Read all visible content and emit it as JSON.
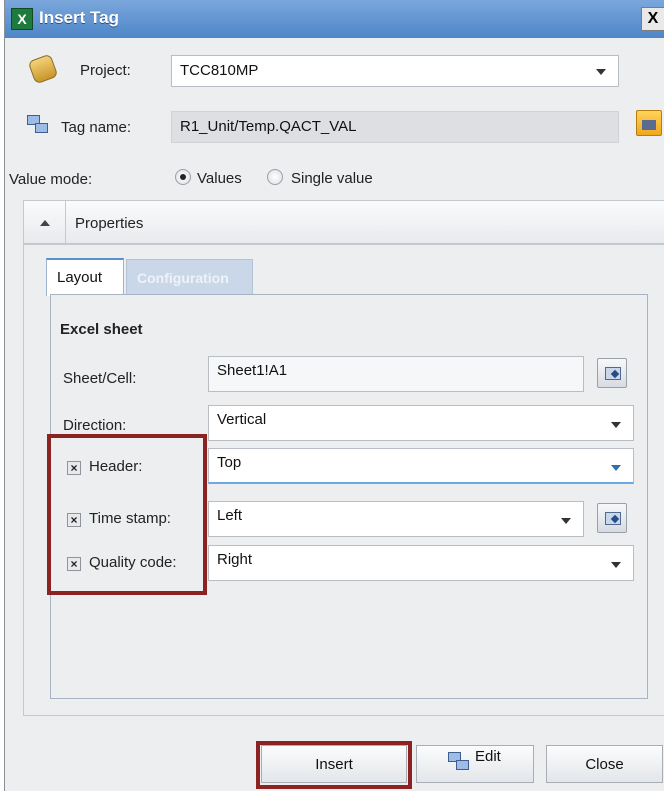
{
  "window": {
    "title": "Insert Tag",
    "close_glyph": "X"
  },
  "project": {
    "label": "Project:",
    "value": "TCC810MP"
  },
  "tag": {
    "label": "Tag name:",
    "value": "R1_Unit/Temp.QACT_VAL"
  },
  "value_mode": {
    "label": "Value mode:",
    "options": [
      "Values",
      "Single value"
    ],
    "selected": "Values"
  },
  "properties": {
    "header": "Properties",
    "tabs": [
      "Layout",
      "Configuration"
    ],
    "active_tab": "Layout"
  },
  "excel": {
    "section_title": "Excel sheet",
    "sheet_cell_label": "Sheet/Cell:",
    "sheet_cell_value": "Sheet1!A1",
    "direction_label": "Direction:",
    "direction_value": "Vertical",
    "header_label": "Header:",
    "header_value": "Top",
    "header_checked": true,
    "timestamp_label": "Time stamp:",
    "timestamp_value": "Left",
    "timestamp_checked": true,
    "quality_label": "Quality code:",
    "quality_value": "Right",
    "quality_checked": true
  },
  "buttons": {
    "insert": "Insert",
    "edit": "Edit",
    "close": "Close"
  },
  "icons": {
    "title": "excel-icon",
    "project": "paperclip-icon",
    "tag": "tag-icon",
    "browse": "folder-browse-icon",
    "pick": "cell-picker-icon"
  },
  "colors": {
    "titlebar": "#4d86c8",
    "highlight_border": "#8b2323"
  }
}
